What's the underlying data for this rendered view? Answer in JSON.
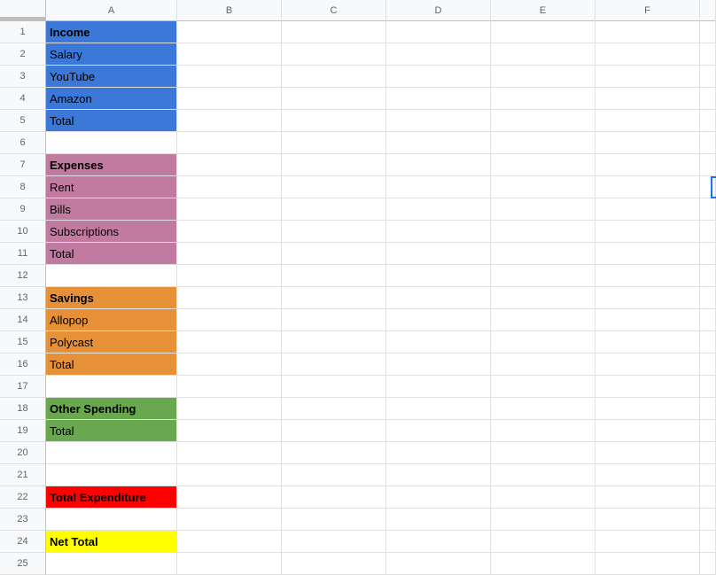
{
  "columns": [
    "A",
    "B",
    "C",
    "D",
    "E",
    "F"
  ],
  "rows": [
    {
      "n": 1,
      "a": "Income",
      "bold": true,
      "bg": "bg-blue"
    },
    {
      "n": 2,
      "a": "Salary",
      "bold": false,
      "bg": "bg-blue"
    },
    {
      "n": 3,
      "a": "YouTube",
      "bold": false,
      "bg": "bg-blue"
    },
    {
      "n": 4,
      "a": "Amazon",
      "bold": false,
      "bg": "bg-blue"
    },
    {
      "n": 5,
      "a": "Total",
      "bold": false,
      "bg": "bg-blue"
    },
    {
      "n": 6,
      "a": "",
      "bold": false,
      "bg": ""
    },
    {
      "n": 7,
      "a": "Expenses",
      "bold": true,
      "bg": "bg-purple"
    },
    {
      "n": 8,
      "a": "Rent",
      "bold": false,
      "bg": "bg-purple"
    },
    {
      "n": 9,
      "a": "Bills",
      "bold": false,
      "bg": "bg-purple"
    },
    {
      "n": 10,
      "a": "Subscriptions",
      "bold": false,
      "bg": "bg-purple"
    },
    {
      "n": 11,
      "a": "Total",
      "bold": false,
      "bg": "bg-purple"
    },
    {
      "n": 12,
      "a": "",
      "bold": false,
      "bg": ""
    },
    {
      "n": 13,
      "a": "Savings",
      "bold": true,
      "bg": "bg-orange"
    },
    {
      "n": 14,
      "a": "Allopop",
      "bold": false,
      "bg": "bg-orange"
    },
    {
      "n": 15,
      "a": "Polycast",
      "bold": false,
      "bg": "bg-orange"
    },
    {
      "n": 16,
      "a": "Total",
      "bold": false,
      "bg": "bg-orange"
    },
    {
      "n": 17,
      "a": "",
      "bold": false,
      "bg": ""
    },
    {
      "n": 18,
      "a": "Other Spending",
      "bold": true,
      "bg": "bg-green"
    },
    {
      "n": 19,
      "a": "Total",
      "bold": false,
      "bg": "bg-green"
    },
    {
      "n": 20,
      "a": "",
      "bold": false,
      "bg": ""
    },
    {
      "n": 21,
      "a": "",
      "bold": false,
      "bg": ""
    },
    {
      "n": 22,
      "a": "Total Expenditure",
      "bold": true,
      "bg": "bg-red"
    },
    {
      "n": 23,
      "a": "",
      "bold": false,
      "bg": ""
    },
    {
      "n": 24,
      "a": "Net Total",
      "bold": true,
      "bg": "bg-yellow"
    },
    {
      "n": 25,
      "a": "",
      "bold": false,
      "bg": ""
    }
  ]
}
